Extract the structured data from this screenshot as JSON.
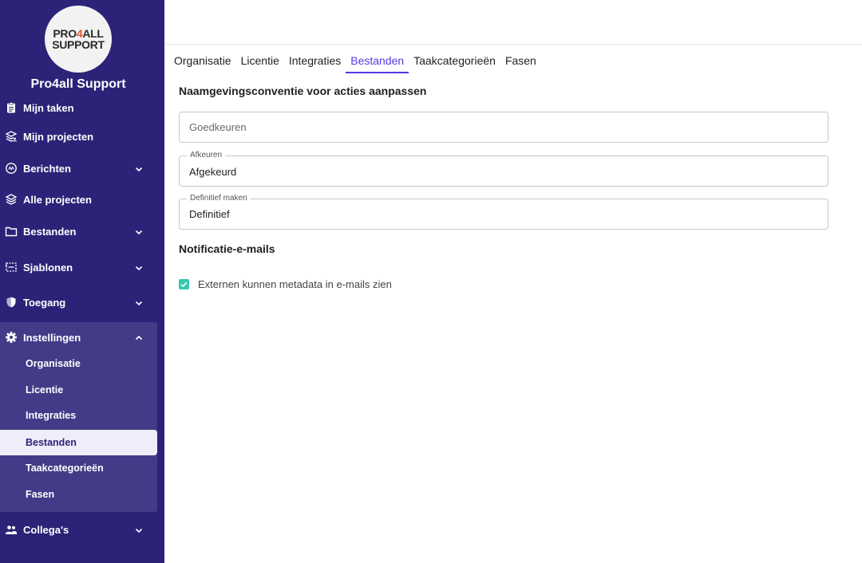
{
  "brand": {
    "logo_line1_a": "PRO",
    "logo_line1_b": "4",
    "logo_line1_c": "ALL",
    "logo_line2": "SUPPORT",
    "org_name": "Pro4all Support",
    "accent_color": "#533be2",
    "sidebar_color": "#2c2378",
    "check_color": "#35c9b0"
  },
  "sidebar": {
    "items": [
      {
        "label": "Mijn taken",
        "icon": "clipboard-icon"
      },
      {
        "label": "Mijn projecten",
        "icon": "layers-user-icon"
      },
      {
        "label": "Berichten",
        "icon": "message-icon",
        "expandable": true
      },
      {
        "label": "Alle projecten",
        "icon": "layers-icon"
      },
      {
        "label": "Bestanden",
        "icon": "folder-icon",
        "expandable": true
      },
      {
        "label": "Sjablonen",
        "icon": "template-icon",
        "expandable": true
      },
      {
        "label": "Toegang",
        "icon": "shield-icon",
        "expandable": true
      },
      {
        "label": "Instellingen",
        "icon": "gear-icon",
        "expanded": true
      },
      {
        "label": "Collega's",
        "icon": "people-icon",
        "expandable": true
      }
    ],
    "settings_sub": [
      {
        "label": "Organisatie"
      },
      {
        "label": "Licentie"
      },
      {
        "label": "Integraties"
      },
      {
        "label": "Bestanden",
        "active": true
      },
      {
        "label": "Taakcategorieën"
      },
      {
        "label": "Fasen"
      }
    ]
  },
  "tabs": [
    {
      "label": "Organisatie"
    },
    {
      "label": "Licentie"
    },
    {
      "label": "Integraties"
    },
    {
      "label": "Bestanden",
      "active": true
    },
    {
      "label": "Taakcategorieën"
    },
    {
      "label": "Fasen"
    }
  ],
  "naming": {
    "title": "Naamgevingsconventie voor acties aanpassen",
    "approve_placeholder": "Goedkeuren",
    "reject_label": "Afkeuren",
    "reject_value": "Afgekeurd",
    "final_label": "Definitief maken",
    "final_value": "Definitief"
  },
  "notifications": {
    "title": "Notificatie-e-mails",
    "external_metadata_label": "Externen kunnen metadata in e-mails zien",
    "external_metadata_checked": true
  }
}
